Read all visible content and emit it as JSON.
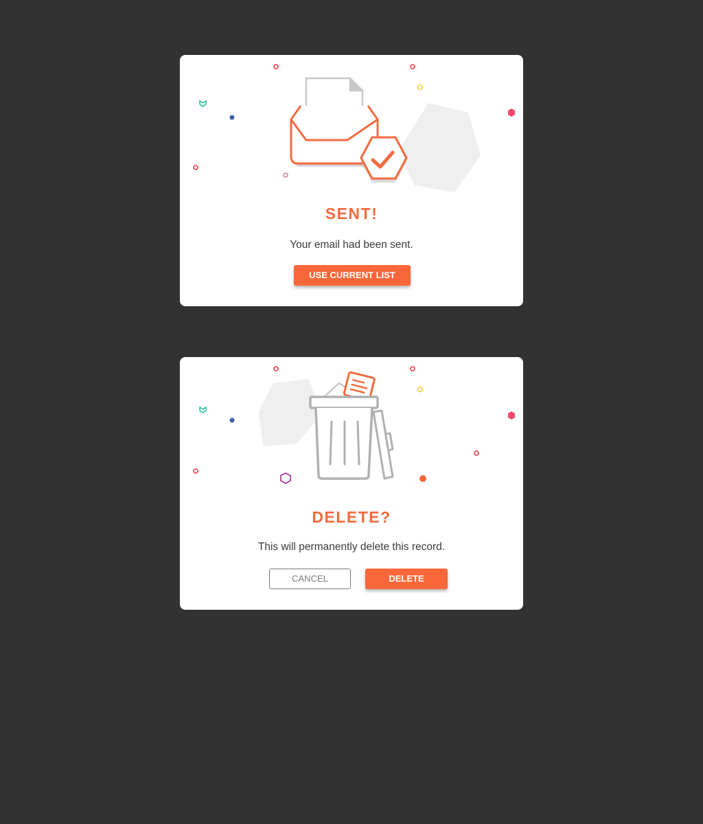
{
  "theme": {
    "background": "#323232",
    "card": "#ffffff",
    "accent": "#f9673a",
    "title_color": "#f46a3d",
    "icon_gray": "#b0b0b0"
  },
  "sent_dialog": {
    "title": "SENT!",
    "message": "Your email had been sent.",
    "primary_button": "USE CURRENT LIST",
    "illustration_icons": [
      "envelope-icon",
      "document-icon",
      "check-badge-icon"
    ]
  },
  "delete_dialog": {
    "title": "DELETE?",
    "message": "This will permanently delete this record.",
    "cancel_button": "CANCEL",
    "delete_button": "DELETE",
    "illustration_icons": [
      "trash-can-icon",
      "document-icon"
    ]
  }
}
